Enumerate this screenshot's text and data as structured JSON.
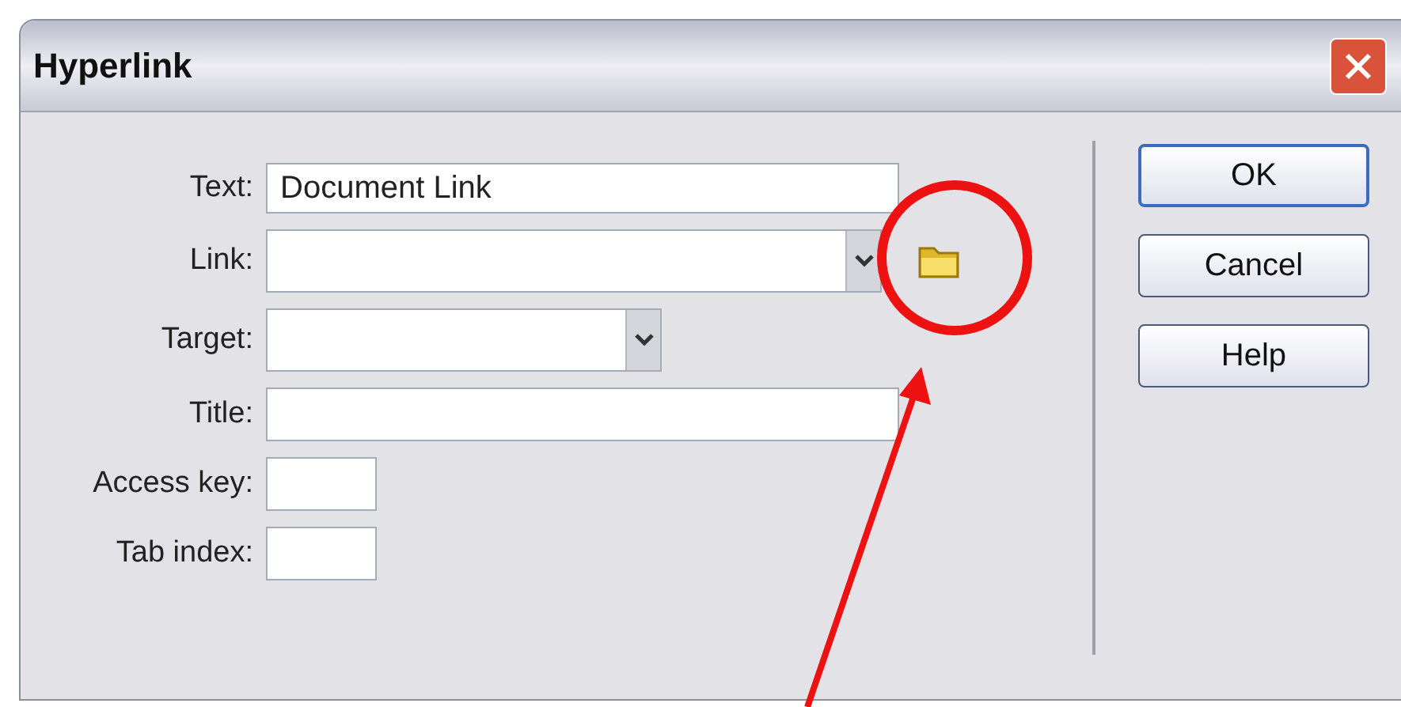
{
  "window": {
    "title": "Hyperlink"
  },
  "fields": [
    {
      "label": "Text:",
      "value": "Document Link",
      "kind": "text"
    },
    {
      "label": "Link:",
      "kind": "combo"
    },
    {
      "label": "Target:",
      "kind": "select"
    },
    {
      "label": "Title:",
      "kind": "text"
    },
    {
      "label": "Access key:",
      "kind": "short"
    },
    {
      "label": "Tab index:",
      "kind": "short"
    }
  ],
  "buttons": [
    {
      "label": "OK",
      "selected": true
    },
    {
      "label": "Cancel",
      "selected": false
    },
    {
      "label": "Help",
      "selected": false
    }
  ]
}
